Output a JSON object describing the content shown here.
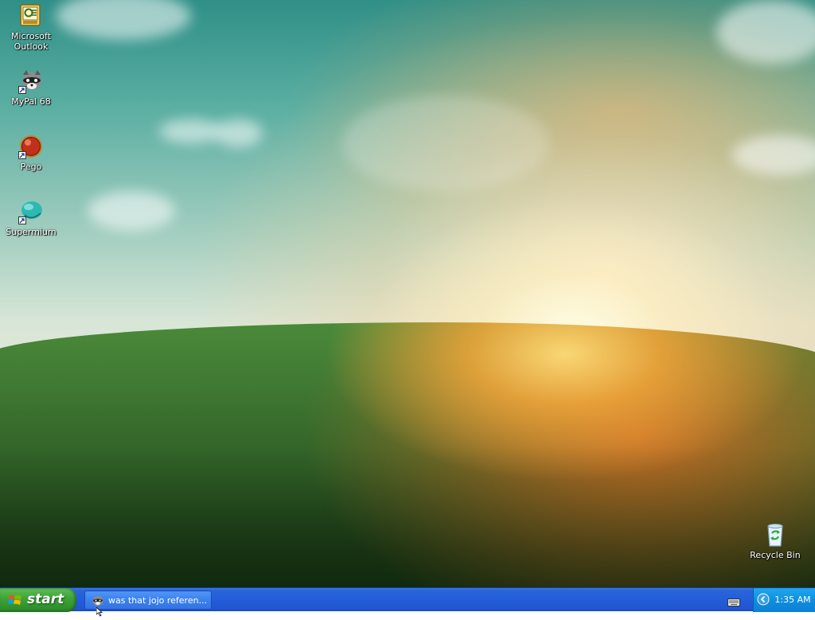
{
  "desktop": {
    "icons": [
      {
        "label": "Microsoft Outlook",
        "icon": "outlook-icon"
      },
      {
        "label": "MyPal 68",
        "icon": "mypal-raccoon-icon"
      },
      {
        "label": "Pego",
        "icon": "pego-orb-icon"
      },
      {
        "label": "Supermium",
        "icon": "supermium-icon"
      },
      {
        "label": "Recycle Bin",
        "icon": "recycle-bin-icon"
      }
    ]
  },
  "taskbar": {
    "start_label": "start",
    "task_button_label": "was that jojo referen...",
    "clock": "1:35 AM",
    "colors": {
      "taskbar": "#245edb",
      "start": "#3fa53a",
      "tray": "#108fe0"
    }
  }
}
